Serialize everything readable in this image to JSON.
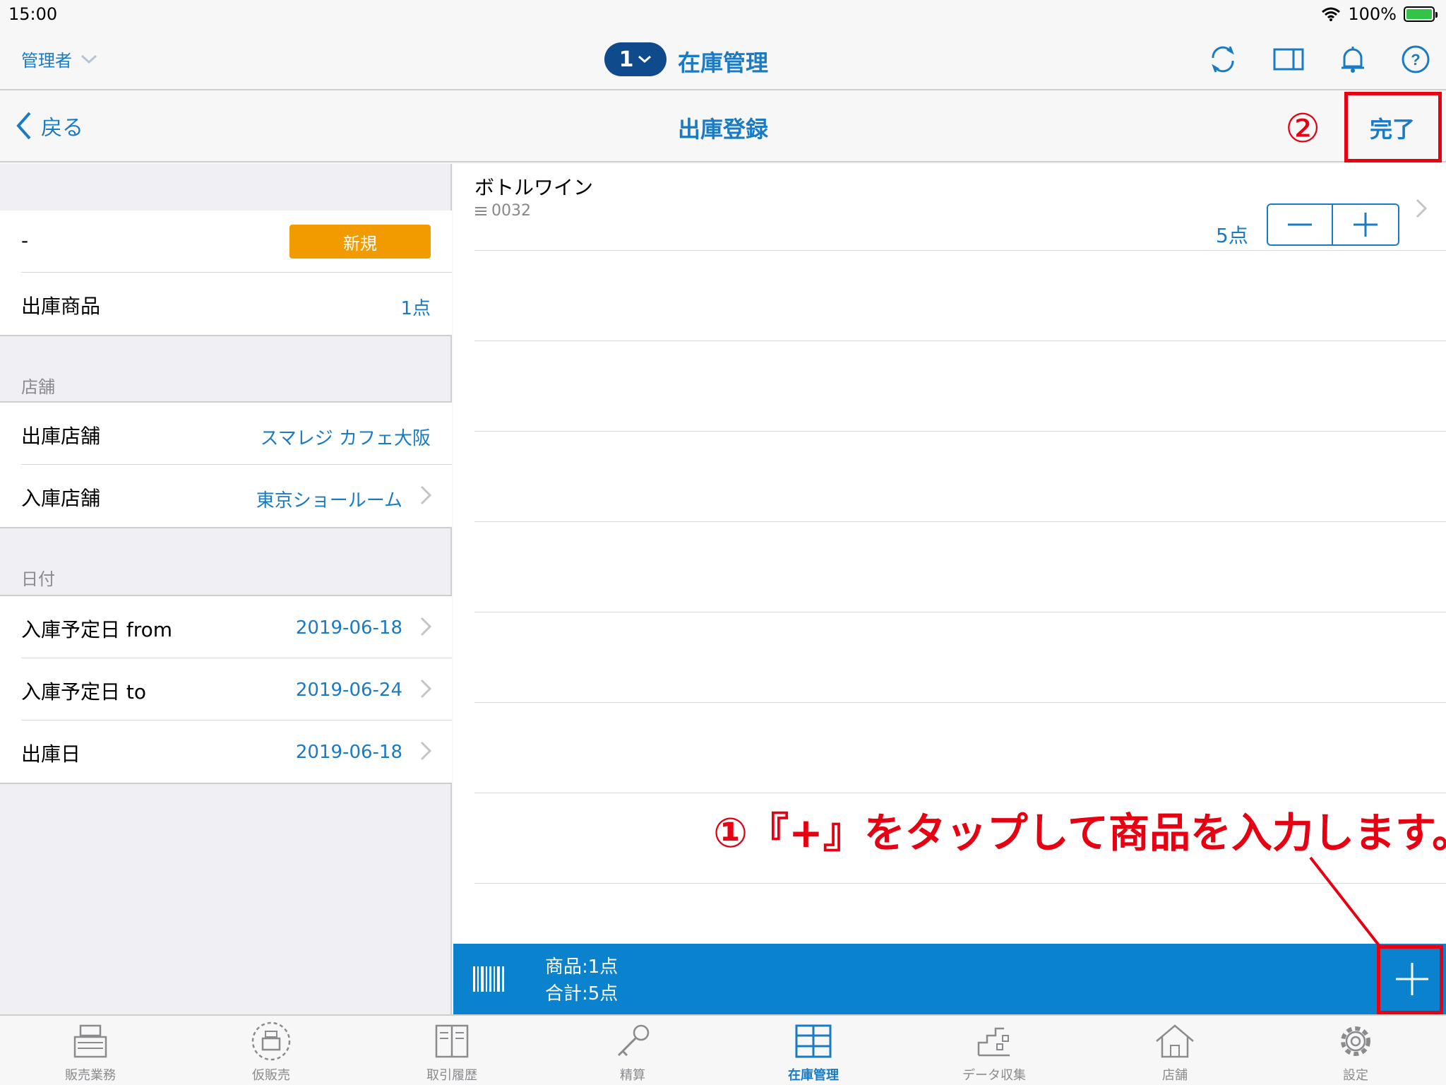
{
  "status_bar": {
    "time": "15:00",
    "battery": "100%"
  },
  "header": {
    "user": "管理者",
    "register_number": "1",
    "title": "在庫管理"
  },
  "nav": {
    "back_label": "戻る",
    "title": "出庫登録",
    "done_label": "完了"
  },
  "left_panel": {
    "status_row": {
      "label": "-",
      "badge": "新規"
    },
    "products_row": {
      "label": "出庫商品",
      "value": "1点"
    },
    "store_section": {
      "header": "店舗",
      "rows": [
        {
          "label": "出庫店舗",
          "value": "スマレジ カフェ大阪"
        },
        {
          "label": "入庫店舗",
          "value": "東京ショールーム"
        }
      ]
    },
    "date_section": {
      "header": "日付",
      "rows": [
        {
          "label": "入庫予定日 from",
          "value": "2019-06-18"
        },
        {
          "label": "入庫予定日 to",
          "value": "2019-06-24"
        },
        {
          "label": "出庫日",
          "value": "2019-06-18"
        }
      ]
    }
  },
  "items": [
    {
      "name": "ボトルワイン",
      "code": "0032",
      "quantity": "5点"
    }
  ],
  "action_bar": {
    "products_summary": "商品:1点",
    "total_summary": "合計:5点"
  },
  "tabs": [
    {
      "label": "販売業務",
      "icon": "register-icon"
    },
    {
      "label": "仮販売",
      "icon": "temp-register-icon"
    },
    {
      "label": "取引履歴",
      "icon": "book-icon"
    },
    {
      "label": "精算",
      "icon": "key-icon"
    },
    {
      "label": "在庫管理",
      "icon": "shelves-icon",
      "active": true
    },
    {
      "label": "データ収集",
      "icon": "data-icon"
    },
    {
      "label": "店舗",
      "icon": "home-icon"
    },
    {
      "label": "設定",
      "icon": "gear-icon"
    }
  ],
  "annotations": {
    "step2": "②",
    "step1": "①『+』をタップして商品を入力します。"
  },
  "colors": {
    "accent": "#1a7bc4",
    "action_bar": "#0a82ce",
    "badge": "#f29b00",
    "annotation": "#e60012"
  }
}
